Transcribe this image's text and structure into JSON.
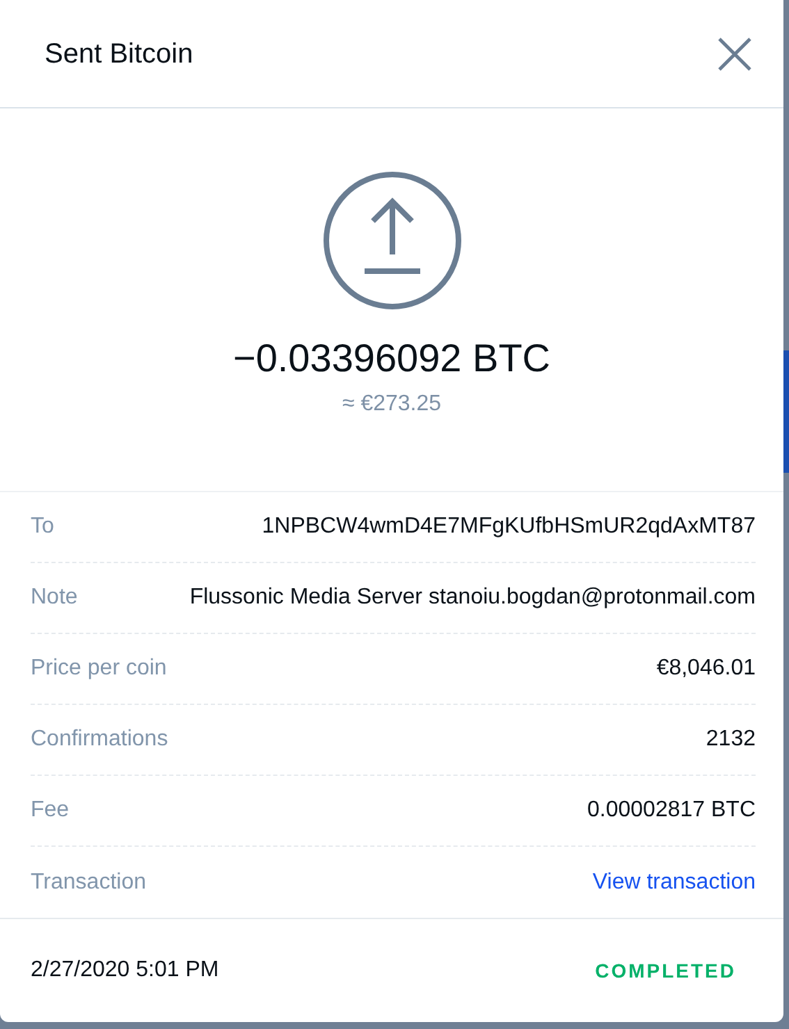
{
  "dialog": {
    "title": "Sent Bitcoin"
  },
  "amount": {
    "value": "−0.03396092 BTC",
    "fiat": "≈ €273.25"
  },
  "details": [
    {
      "label": "To",
      "value": "1NPBCW4wmD4E7MFgKUfbHSmUR2qdAxMT87",
      "kind": "text"
    },
    {
      "label": "Note",
      "value": "Flussonic Media Server stanoiu.bogdan@protonmail.com",
      "kind": "text"
    },
    {
      "label": "Price per coin",
      "value": "€8,046.01",
      "kind": "text"
    },
    {
      "label": "Confirmations",
      "value": "2132",
      "kind": "text"
    },
    {
      "label": "Fee",
      "value": "0.00002817 BTC",
      "kind": "text"
    },
    {
      "label": "Transaction",
      "value": "View transaction",
      "kind": "link"
    }
  ],
  "footer": {
    "date": "2/27/2020 5:01 PM",
    "status": {
      "text": "COMPLETED",
      "kind": "completed"
    }
  }
}
